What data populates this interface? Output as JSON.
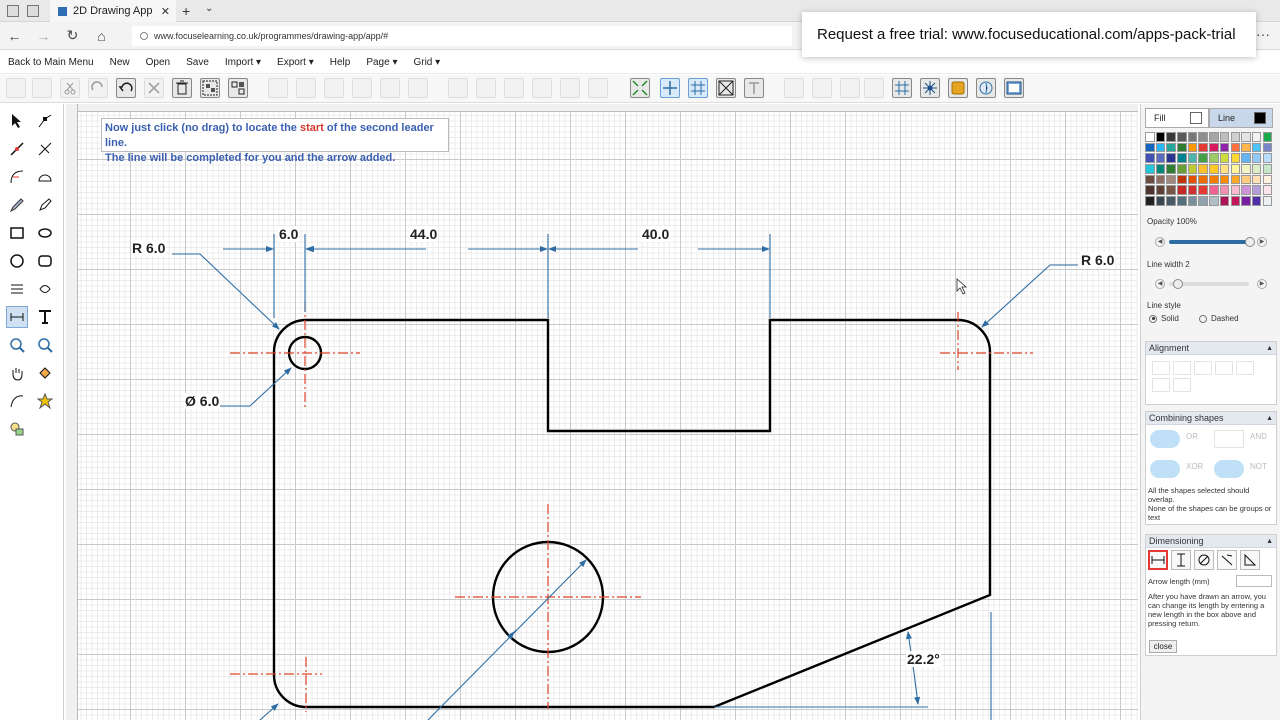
{
  "browser": {
    "tab_title": "2D Drawing App",
    "new_tab": "+",
    "url": "www.focuselearning.co.uk/programmes/drawing-app/app/#",
    "more": "···"
  },
  "promo_banner": "Request a free trial: www.focuseducational.com/apps-pack-trial",
  "menu": {
    "items": [
      "Back to Main Menu",
      "New",
      "Open",
      "Save",
      "Import ▾",
      "Export ▾",
      "Help",
      "Page ▾",
      "Grid ▾"
    ]
  },
  "hint": {
    "line1_a": "Now just click (no drag) to locate the ",
    "line1_highlight": "start",
    "line1_b": " of the second leader line.",
    "line2": "The line will be completed for you and the arrow added."
  },
  "drawing": {
    "dims": {
      "d1": "6.0",
      "d2": "44.0",
      "d3": "40.0",
      "r_left": "R 6.0",
      "r_right": "R 6.0",
      "hole": "Ø 6.0",
      "angle": "22.2°"
    },
    "colors": {
      "outline": "#000000",
      "dim": "#2e6da4",
      "center": "#e0452a"
    }
  },
  "panel": {
    "fill_label": "Fill",
    "line_label": "Line",
    "opacity_label": "Opacity 100%",
    "opacity_value": 1.0,
    "linewidth_label": "Line width 2",
    "linewidth_value": 2,
    "linestyle_label": "Line style",
    "solid_label": "Solid",
    "dashed_label": "Dashed",
    "alignment": "Alignment",
    "combining": "Combining shapes",
    "or": "OR",
    "and": "AND",
    "xor": "XOR",
    "not": "NOT",
    "combining_note": "All the shapes selected should overlap.\nNone of the shapes can be groups or text",
    "dimensioning": "Dimensioning",
    "arrow_length_label": "Arrow length (mm)",
    "dim_note": "After you have drawn an arrow, you can change its length by entering a new length in the box above and pressing return.",
    "close": "close",
    "palette": [
      "#ffffff",
      "#000000",
      "#3a3a3a",
      "#5a5a5a",
      "#777777",
      "#8e8e8e",
      "#a6a6a6",
      "#bdbdbd",
      "#d0d0d0",
      "#e3e3e3",
      "#f2f2f2",
      "#1aa84a",
      "#1565c0",
      "#29b6f6",
      "#26a69a",
      "#2e7d32",
      "#ff9800",
      "#e53935",
      "#d81b60",
      "#8e24aa",
      "#ff7043",
      "#ffb74d",
      "#4fc3f7",
      "#7986cb",
      "#3f51b5",
      "#5c6bc0",
      "#283593",
      "#00838f",
      "#4db6ac",
      "#43a047",
      "#9ccc65",
      "#cddc39",
      "#fdd835",
      "#64b5f6",
      "#90caf9",
      "#bbdefb",
      "#26c6da",
      "#00897b",
      "#2e7d32",
      "#689f38",
      "#c0ca33",
      "#fbc02d",
      "#ffca28",
      "#ffe082",
      "#fff59d",
      "#f0f4c3",
      "#dcedc8",
      "#c8e6c9",
      "#6d4c41",
      "#8d6e63",
      "#a1887f",
      "#bf360c",
      "#e65100",
      "#ef6c00",
      "#f57c00",
      "#fb8c00",
      "#ffa726",
      "#ffcc80",
      "#ffe0b2",
      "#fff3e0",
      "#4e342e",
      "#5d4037",
      "#795548",
      "#c62828",
      "#d32f2f",
      "#e53935",
      "#f06292",
      "#f48fb1",
      "#f8bbd0",
      "#ce93d8",
      "#b39ddb",
      "#fce4ec",
      "#212121",
      "#37474f",
      "#455a64",
      "#546e7a",
      "#78909c",
      "#90a4ae",
      "#b0bec5",
      "#ad1457",
      "#c2185b",
      "#7b1fa2",
      "#512da8",
      "#eceff1"
    ]
  }
}
